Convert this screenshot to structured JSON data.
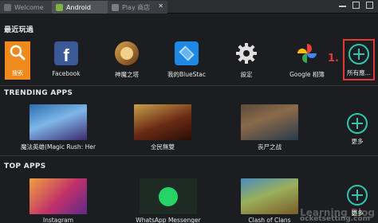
{
  "tabs": [
    {
      "label": "Welcome",
      "icon": "bluestacks-icon"
    },
    {
      "label": "Android",
      "icon": "android-icon"
    },
    {
      "label": "Play 商店",
      "icon": "play-store-icon"
    }
  ],
  "recent": {
    "title": "最近玩過",
    "search_label": "搜索",
    "apps": [
      {
        "label": "Facebook",
        "icon": "facebook-icon"
      },
      {
        "label": "神魔之塔",
        "icon": "game-icon"
      },
      {
        "label": "我的BlueStac",
        "icon": "bluestacks-icon"
      },
      {
        "label": "設定",
        "icon": "gear-icon"
      },
      {
        "label": "Google 相簿",
        "icon": "google-photos-icon"
      }
    ],
    "all_label": "所有應...",
    "annotation": "1."
  },
  "trending": {
    "title": "TRENDING APPS",
    "apps": [
      {
        "label": "魔法英雄(Magic Rush: Her"
      },
      {
        "label": "全民無雙"
      },
      {
        "label": "丧尸之战"
      }
    ],
    "more_label": "更多"
  },
  "top": {
    "title": "TOP APPS",
    "apps": [
      {
        "label": "Instagram"
      },
      {
        "label": "WhatsApp Messenger"
      },
      {
        "label": "Clash of Clans"
      }
    ],
    "more_label": "更多"
  },
  "watermark": "Learning Blog",
  "watermark_sub": "ocketsetting.com",
  "colors": {
    "accent": "#2bc5b2",
    "search_tile": "#f08a1c",
    "highlight": "#e53935",
    "background": "#1b1d20"
  }
}
